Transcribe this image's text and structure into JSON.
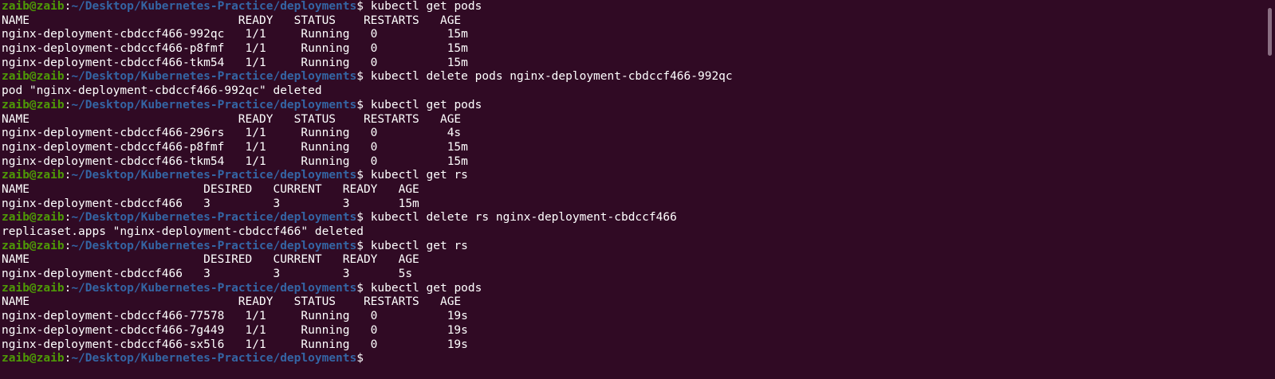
{
  "prompt": {
    "user": "zaib@zaib",
    "separator": ":",
    "path": "~/Desktop/Kubernetes-Practice/deployments",
    "symbol": "$"
  },
  "colors": {
    "background": "#300a24",
    "user": "#4e9a06",
    "path": "#3465a4",
    "text": "#ffffff"
  },
  "lines": [
    {
      "type": "prompt",
      "cmd": " kubectl get pods"
    },
    {
      "type": "output",
      "text": "NAME                              READY   STATUS    RESTARTS   AGE"
    },
    {
      "type": "output",
      "text": "nginx-deployment-cbdccf466-992qc   1/1     Running   0          15m"
    },
    {
      "type": "output",
      "text": "nginx-deployment-cbdccf466-p8fmf   1/1     Running   0          15m"
    },
    {
      "type": "output",
      "text": "nginx-deployment-cbdccf466-tkm54   1/1     Running   0          15m"
    },
    {
      "type": "prompt",
      "cmd": " kubectl delete pods nginx-deployment-cbdccf466-992qc"
    },
    {
      "type": "output",
      "text": "pod \"nginx-deployment-cbdccf466-992qc\" deleted"
    },
    {
      "type": "prompt",
      "cmd": " kubectl get pods"
    },
    {
      "type": "output",
      "text": "NAME                              READY   STATUS    RESTARTS   AGE"
    },
    {
      "type": "output",
      "text": "nginx-deployment-cbdccf466-296rs   1/1     Running   0          4s"
    },
    {
      "type": "output",
      "text": "nginx-deployment-cbdccf466-p8fmf   1/1     Running   0          15m"
    },
    {
      "type": "output",
      "text": "nginx-deployment-cbdccf466-tkm54   1/1     Running   0          15m"
    },
    {
      "type": "prompt",
      "cmd": " kubectl get rs"
    },
    {
      "type": "output",
      "text": "NAME                         DESIRED   CURRENT   READY   AGE"
    },
    {
      "type": "output",
      "text": "nginx-deployment-cbdccf466   3         3         3       15m"
    },
    {
      "type": "prompt",
      "cmd": " kubectl delete rs nginx-deployment-cbdccf466"
    },
    {
      "type": "output",
      "text": "replicaset.apps \"nginx-deployment-cbdccf466\" deleted"
    },
    {
      "type": "prompt",
      "cmd": " kubectl get rs"
    },
    {
      "type": "output",
      "text": "NAME                         DESIRED   CURRENT   READY   AGE"
    },
    {
      "type": "output",
      "text": "nginx-deployment-cbdccf466   3         3         3       5s"
    },
    {
      "type": "prompt",
      "cmd": " kubectl get pods"
    },
    {
      "type": "output",
      "text": "NAME                              READY   STATUS    RESTARTS   AGE"
    },
    {
      "type": "output",
      "text": "nginx-deployment-cbdccf466-77578   1/1     Running   0          19s"
    },
    {
      "type": "output",
      "text": "nginx-deployment-cbdccf466-7g449   1/1     Running   0          19s"
    },
    {
      "type": "output",
      "text": "nginx-deployment-cbdccf466-sx5l6   1/1     Running   0          19s"
    },
    {
      "type": "prompt",
      "cmd": ""
    }
  ]
}
